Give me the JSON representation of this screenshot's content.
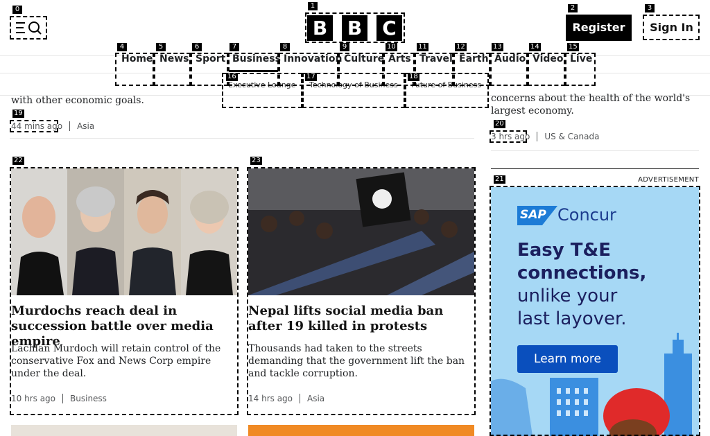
{
  "header": {
    "logo_letters": [
      "B",
      "B",
      "C"
    ],
    "register_label": "Register",
    "signin_label": "Sign In",
    "menu_icon": "menu-search-icon"
  },
  "nav": {
    "items": [
      "Home",
      "News",
      "Sport",
      "Business",
      "Innovation",
      "Culture",
      "Arts",
      "Travel",
      "Earth",
      "Audio",
      "Video",
      "Live"
    ],
    "active": "Business",
    "sub_items": [
      "Executive Lounge",
      "Technology of Business",
      "Future of Business"
    ]
  },
  "left_top": {
    "snippet": "with other economic goals.",
    "time": "44 mins ago",
    "section": "Asia"
  },
  "right_top": {
    "snippet_line1": "concerns about the health of the world's",
    "snippet_line2": "largest economy.",
    "time": "3 hrs ago",
    "section": "US & Canada"
  },
  "cards": [
    {
      "headline": "Murdochs reach deal in succession battle over media empire",
      "summary": "Lachlan Murdoch will retain control of the conservative Fox and News Corp empire under the deal.",
      "time": "10 hrs ago",
      "section": "Business"
    },
    {
      "headline": "Nepal lifts social media ban after 19 killed in protests",
      "summary": "Thousands had taken to the streets demanding that the government lift the ban and tackle corruption.",
      "time": "14 hrs ago",
      "section": "Asia"
    }
  ],
  "ad": {
    "label": "ADVERTISEMENT",
    "brand_sap": "SAP",
    "brand_name": "Concur",
    "line1": "Easy T&E",
    "line2": "connections,",
    "line3": "unlike your",
    "line4": "last layover.",
    "cta": "Learn more"
  },
  "markers": [
    "0",
    "1",
    "2",
    "3",
    "4",
    "5",
    "6",
    "7",
    "8",
    "9",
    "10",
    "11",
    "12",
    "13",
    "14",
    "15",
    "16",
    "17",
    "18",
    "19",
    "20",
    "21",
    "22",
    "23"
  ],
  "colors": {
    "ad_bg": "#a6d8f5",
    "ad_text": "#1b1f5e",
    "ad_cta": "#0a4fbd",
    "sap_blue": "#1c7bd6"
  }
}
